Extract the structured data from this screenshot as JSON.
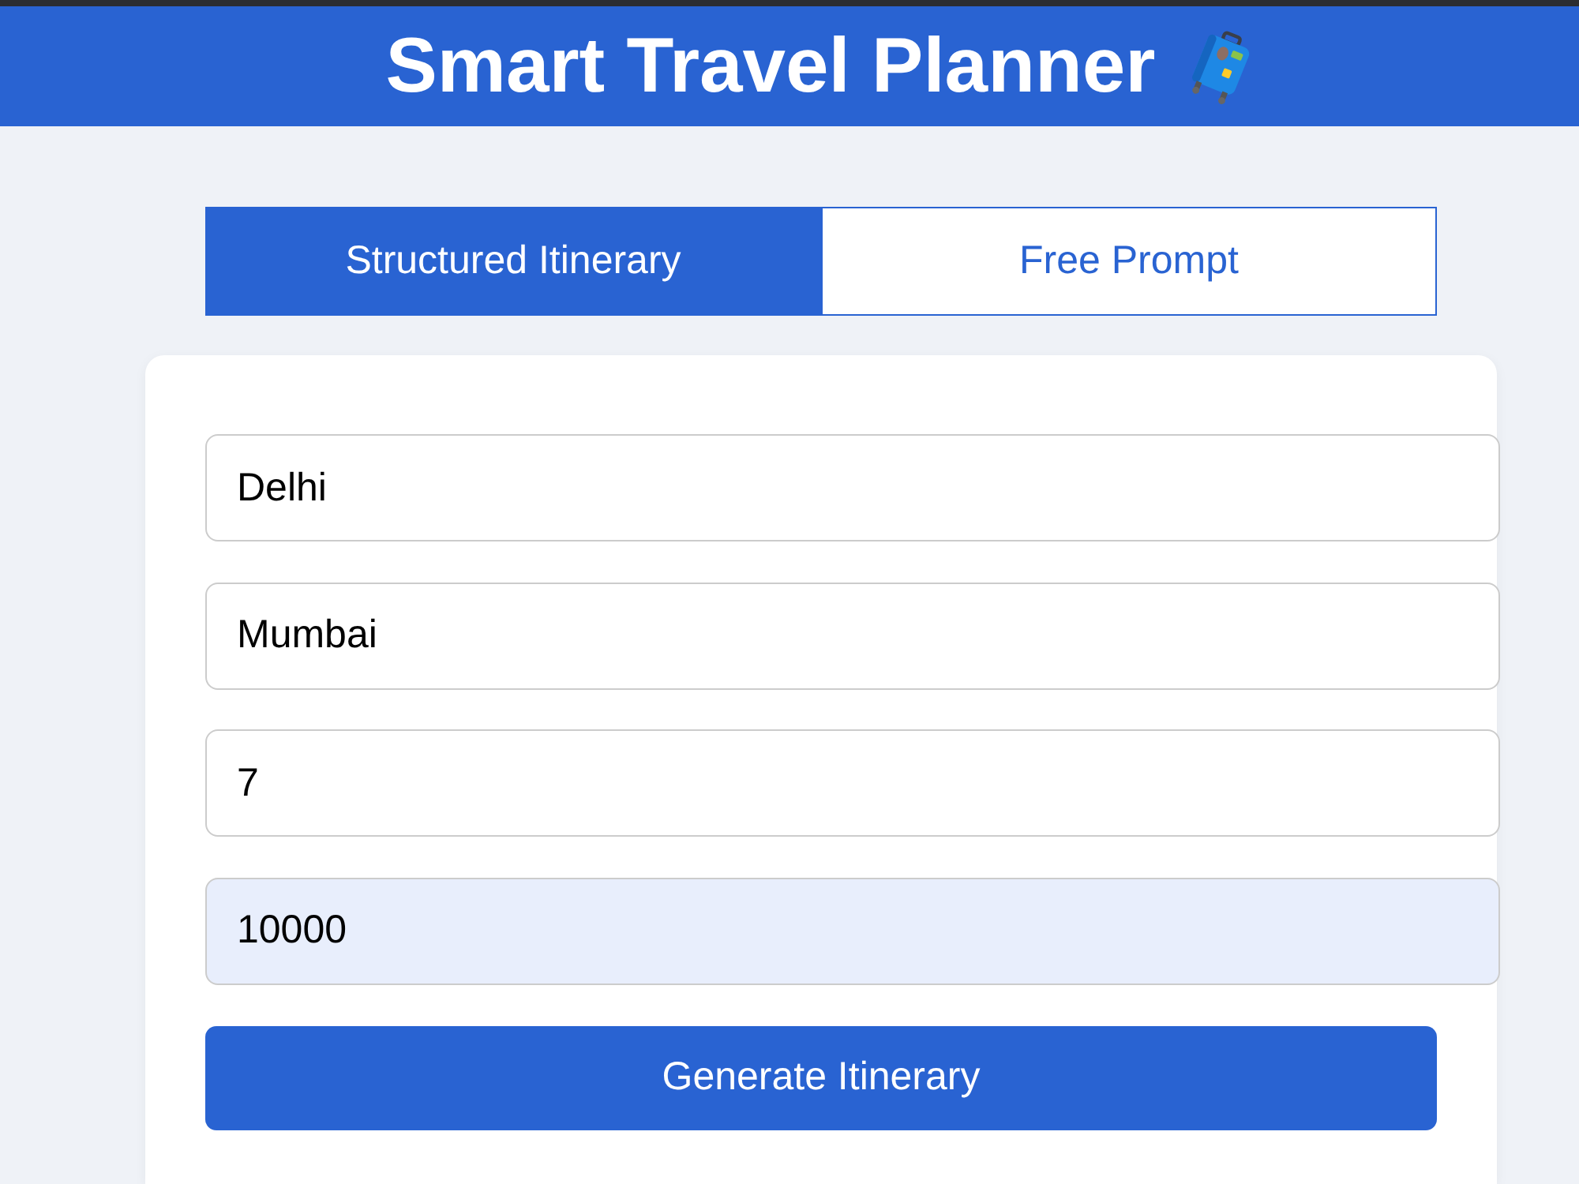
{
  "header": {
    "title": "Smart Travel Planner"
  },
  "tabs": [
    {
      "label": "Structured Itinerary",
      "selected": true
    },
    {
      "label": "Free Prompt",
      "selected": false
    }
  ],
  "form": {
    "fields": [
      {
        "value": "Delhi",
        "autofilled": false
      },
      {
        "value": "Mumbai",
        "autofilled": false
      },
      {
        "value": "7",
        "autofilled": false
      },
      {
        "value": "10000",
        "autofilled": true
      }
    ],
    "submit_button": "Generate Itinerary"
  }
}
